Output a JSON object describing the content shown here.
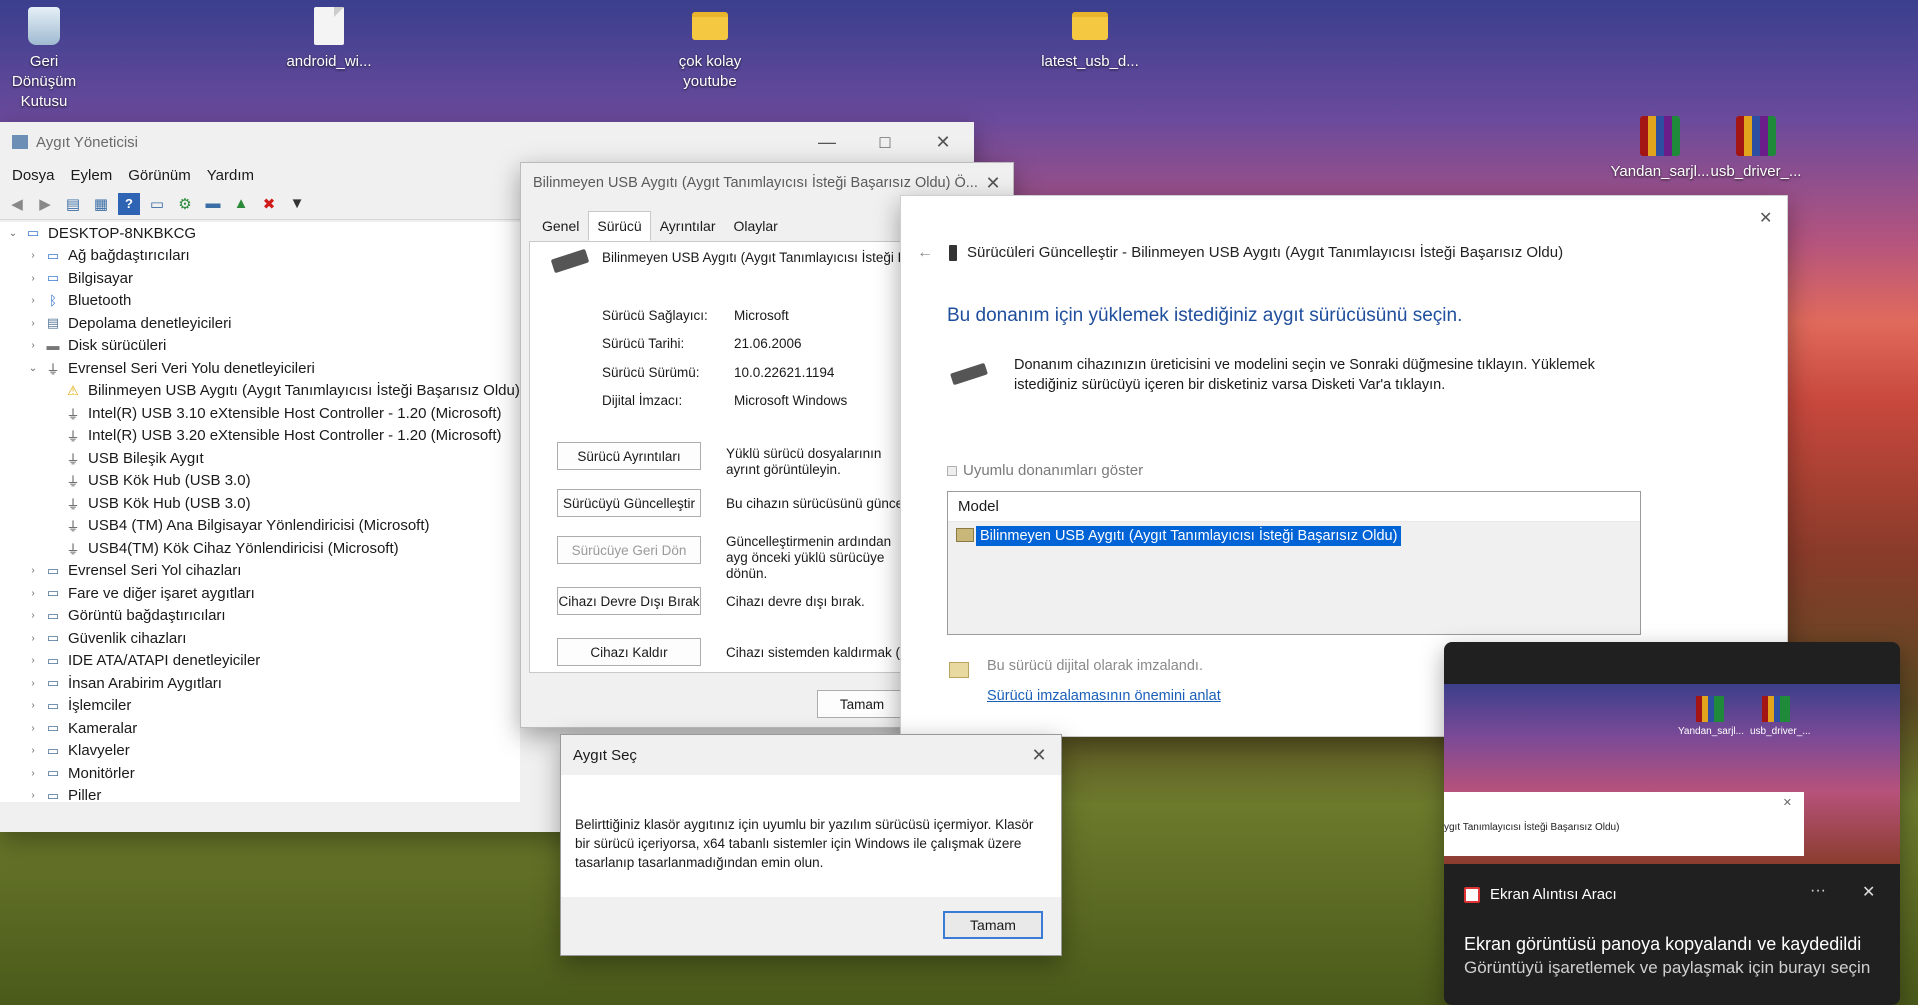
{
  "desktop": {
    "icons": [
      {
        "label": "Geri Dönüşüm Kutusu",
        "icon": "recycle-bin-icon"
      },
      {
        "label": "android_wi...",
        "icon": "file-icon"
      },
      {
        "label": "çok kolay youtube",
        "icon": "folder-icon"
      },
      {
        "label": "latest_usb_d...",
        "icon": "folder-icon"
      },
      {
        "label": "Yandan_sarjl...",
        "icon": "rar-archive-icon"
      },
      {
        "label": "usb_driver_...",
        "icon": "rar-archive-icon"
      }
    ]
  },
  "devmgr": {
    "title": "Aygıt Yöneticisi",
    "menu": [
      "Dosya",
      "Eylem",
      "Görünüm",
      "Yardım"
    ],
    "root": "DESKTOP-8NKBKCG",
    "categories_top": [
      "Ağ bağdaştırıcıları",
      "Bilgisayar",
      "Bluetooth",
      "Depolama denetleyicileri",
      "Disk sürücüleri"
    ],
    "usb_category": "Evrensel Seri Veri Yolu denetleyicileri",
    "usb_children": [
      "Bilinmeyen USB Aygıtı (Aygıt Tanımlayıcısı İsteği Başarısız Oldu)",
      "Intel(R) USB 3.10 eXtensible Host Controller - 1.20 (Microsoft)",
      "Intel(R) USB 3.20 eXtensible Host Controller - 1.20 (Microsoft)",
      "USB Bileşik Aygıt",
      "USB Kök Hub (USB 3.0)",
      "USB Kök Hub (USB 3.0)",
      "USB4 (TM) Ana Bilgisayar Yönlendiricisi (Microsoft)",
      "USB4(TM) Kök Cihaz Yönlendiricisi (Microsoft)"
    ],
    "categories_bottom": [
      "Evrensel Seri Yol cihazları",
      "Fare ve diğer işaret aygıtları",
      "Görüntü bağdaştırıcıları",
      "Güvenlik cihazları",
      "IDE ATA/ATAPI denetleyiciler",
      "İnsan Arabirim Aygıtları",
      "İşlemciler",
      "Kameralar",
      "Klavyeler",
      "Monitörler",
      "Piller"
    ]
  },
  "props": {
    "title": "Bilinmeyen USB Aygıtı (Aygıt Tanımlayıcısı İsteği Başarısız Oldu) Ö...",
    "tabs": [
      "Genel",
      "Sürücü",
      "Ayrıntılar",
      "Olaylar"
    ],
    "device_name": "Bilinmeyen USB Aygıtı (Aygıt Tanımlayıcısı İsteği Ba",
    "fields": [
      {
        "label": "Sürücü Sağlayıcı:",
        "value": "Microsoft"
      },
      {
        "label": "Sürücü Tarihi:",
        "value": "21.06.2006"
      },
      {
        "label": "Sürücü Sürümü:",
        "value": "10.0.22621.1194"
      },
      {
        "label": "Dijital İmzacı:",
        "value": "Microsoft Windows"
      }
    ],
    "buttons": [
      {
        "label": "Sürücü Ayrıntıları",
        "desc": "Yüklü sürücü dosyalarının ayrınt görüntüleyin."
      },
      {
        "label": "Sürücüyü Güncelleştir",
        "desc": "Bu cihazın sürücüsünü güncelle"
      },
      {
        "label": "Sürücüye Geri Dön",
        "desc": "Güncelleştirmenin ardından ayg önceki yüklü sürücüye dönün."
      },
      {
        "label": "Cihazı Devre Dışı Bırak",
        "desc": "Cihazı devre dışı bırak."
      },
      {
        "label": "Cihazı Kaldır",
        "desc": "Cihazı sistemden kaldırmak (Ge"
      }
    ],
    "ok": "Tamam"
  },
  "wizard": {
    "title": "Sürücüleri Güncelleştir - Bilinmeyen USB Aygıtı (Aygıt Tanımlayıcısı İsteği Başarısız Oldu)",
    "heading": "Bu donanım için yüklemek istediğiniz aygıt sürücüsünü seçin.",
    "desc": "Donanım cihazınızın üreticisini ve modelini seçin ve Sonraki düğmesine tıklayın. Yüklemek istediğiniz sürücüyü içeren bir disketiniz varsa Disketi Var'a tıklayın.",
    "checkbox": "Uyumlu donanımları göster",
    "list_header": "Model",
    "list_selected": "Bilinmeyen USB Aygıtı (Aygıt Tanımlayıcısı İsteği Başarısız Oldu)",
    "signed_text": "Bu sürücü dijital olarak imzalandı.",
    "link": "Sürücü imzalamasının önemini anlat"
  },
  "select_device": {
    "title": "Aygıt Seç",
    "message": "Belirttiğiniz klasör aygıtınız için uyumlu bir yazılım sürücüsü içermiyor. Klasör bir sürücü içeriyorsa, x64 tabanlı sistemler için Windows ile çalışmak üzere tasarlanıp tasarlanmadığından emin olun.",
    "ok": "Tamam"
  },
  "toast": {
    "preview_icons": [
      "Yandan_sarjl...",
      "usb_driver_..."
    ],
    "preview_text": "ygıt Tanımlayıcısı İsteği Başarısız Oldu)",
    "app_name": "Ekran Alıntısı Aracı",
    "more": "···",
    "title": "Ekran görüntüsü panoya kopyalandı ve kaydedildi",
    "body": "Görüntüyü işaretlemek ve paylaşmak için burayı seçin"
  },
  "colors": {
    "accent": "#0063d6",
    "link": "#1b5fb8",
    "heading": "#1f4e9c",
    "warning": "#f2b400",
    "delete": "#d11a1a"
  }
}
